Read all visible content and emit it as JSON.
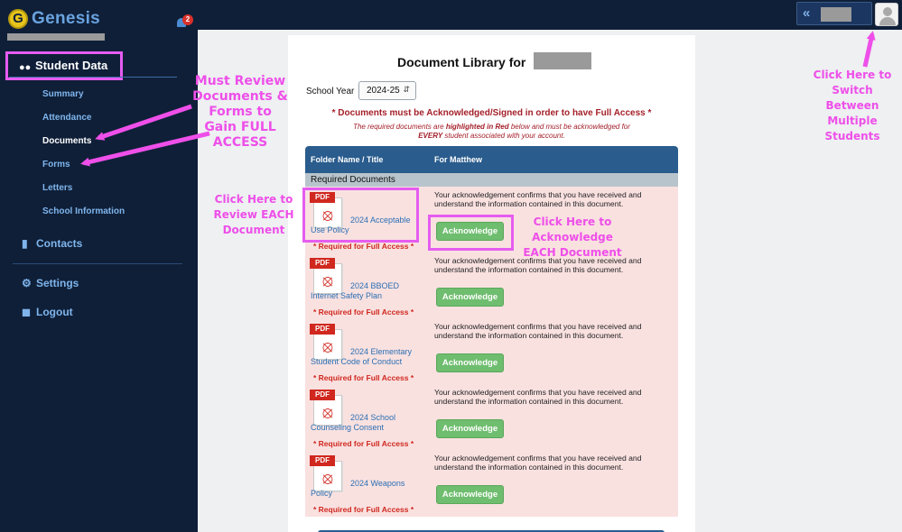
{
  "brand": {
    "name": "Genesis",
    "logo_letter": "G"
  },
  "notifications": {
    "count": "2"
  },
  "sidebar": {
    "student_data_label": "Student Data",
    "sub_items": [
      {
        "label": "Summary"
      },
      {
        "label": "Attendance"
      },
      {
        "label": "Documents",
        "active": true
      },
      {
        "label": "Forms"
      },
      {
        "label": "Letters"
      },
      {
        "label": "School Information"
      }
    ],
    "contacts_label": "Contacts",
    "settings_label": "Settings",
    "logout_label": "Logout"
  },
  "icons": {
    "collapse": "chevrons-left-icon",
    "student": "users-icon",
    "contacts": "book-icon",
    "settings": "gear-icon",
    "logout": "lock-icon",
    "bell": "bell-icon",
    "avatar": "user-avatar-icon",
    "document": "pdf-file-icon"
  },
  "main": {
    "title": "Document Library for",
    "school_year_label": "School Year",
    "school_year_value": "2024-25",
    "warning": "* Documents must be Acknowledged/Signed in order to have Full Access *",
    "note_part1": "The required documents are ",
    "note_bold": "highlighted in Red",
    "note_part2": " below and must be acknowledged for",
    "note_line2_bold": "EVERY",
    "note_line2_rest": " student associated with your account.",
    "table": {
      "col1": "Folder Name / Title",
      "col2": "For Matthew",
      "section": "Required Documents",
      "rows": [
        {
          "title": "2024 Acceptable Use Policy",
          "required": "* Required for Full Access *",
          "ack_text": "Your acknowledgement confirms that you have received and understand the information contained in this document.",
          "button": "Acknowledge"
        },
        {
          "title": "2024 BBOED Internet Safety Plan",
          "required": "* Required for Full Access *",
          "ack_text": "Your acknowledgement confirms that you have received and understand the information contained in this document.",
          "button": "Acknowledge"
        },
        {
          "title": "2024 Elementary Student Code of Conduct",
          "required": "* Required for Full Access *",
          "ack_text": "Your acknowledgement confirms that you have received and understand the information contained in this document.",
          "button": "Acknowledge"
        },
        {
          "title": "2024 School Counseling Consent",
          "required": "* Required for Full Access *",
          "ack_text": "Your acknowledgement confirms that you have received and understand the information contained in this document.",
          "button": "Acknowledge"
        },
        {
          "title": "2024 Weapons Policy",
          "required": "* Required for Full Access *",
          "ack_text": "Your acknowledgement confirms that you have received and understand the information contained in this document.",
          "button": "Acknowledge"
        }
      ]
    }
  },
  "annotations": {
    "must_review": [
      "Must Review",
      "Documents &",
      "Forms to",
      "Gain FULL",
      "ACCESS"
    ],
    "click_review": [
      "Click Here to",
      "Review EACH",
      "Document"
    ],
    "click_ack": [
      "Click Here to",
      "Acknowledge",
      "EACH Document"
    ],
    "click_switch": [
      "Click Here to",
      "Switch",
      "Between",
      "Multiple",
      "Students"
    ]
  },
  "colors": {
    "sidebar_bg": "#0f1f38",
    "link_blue": "#7fb5ec",
    "annotation_pink": "#ee4fe9",
    "table_head": "#2a5c8d",
    "required_red": "#d0281f",
    "row_bg": "#f9e1e0",
    "button_green": "#6fbd6f"
  }
}
